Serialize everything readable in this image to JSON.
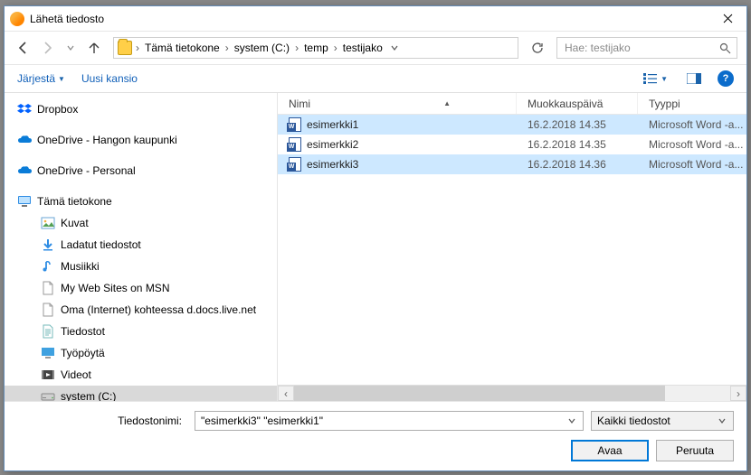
{
  "window": {
    "title": "Lähetä tiedosto"
  },
  "breadcrumb": {
    "segments": [
      "Tämä tietokone",
      "system (C:)",
      "temp",
      "testijako"
    ]
  },
  "search": {
    "placeholder": "Hae: testijako"
  },
  "toolbar": {
    "organize": "Järjestä",
    "new_folder": "Uusi kansio"
  },
  "columns": {
    "name": "Nimi",
    "modified": "Muokkauspäivä",
    "type": "Tyyppi"
  },
  "sidebar": {
    "items": [
      {
        "key": "dropbox",
        "label": "Dropbox",
        "icon": "dropbox",
        "indent": false
      },
      {
        "key": "spacer"
      },
      {
        "key": "od-hanko",
        "label": "OneDrive - Hangon kaupunki",
        "icon": "onedrive",
        "indent": false
      },
      {
        "key": "spacer"
      },
      {
        "key": "od-pers",
        "label": "OneDrive - Personal",
        "icon": "onedrive",
        "indent": false
      },
      {
        "key": "spacer"
      },
      {
        "key": "thispc",
        "label": "Tämä tietokone",
        "icon": "pc",
        "indent": false
      },
      {
        "key": "pictures",
        "label": "Kuvat",
        "icon": "img",
        "indent": true
      },
      {
        "key": "downloads",
        "label": "Ladatut tiedostot",
        "icon": "download",
        "indent": true
      },
      {
        "key": "music",
        "label": "Musiikki",
        "icon": "music",
        "indent": true
      },
      {
        "key": "msn",
        "label": "My Web Sites on MSN",
        "icon": "file",
        "indent": true
      },
      {
        "key": "oma",
        "label": "Oma (Internet) kohteessa d.docs.live.net",
        "icon": "file",
        "indent": true
      },
      {
        "key": "docs",
        "label": "Tiedostot",
        "icon": "doc",
        "indent": true
      },
      {
        "key": "desktop",
        "label": "Työpöytä",
        "icon": "desktop",
        "indent": true
      },
      {
        "key": "videos",
        "label": "Videot",
        "icon": "video",
        "indent": true
      },
      {
        "key": "systemc",
        "label": "system (C:)",
        "icon": "drive",
        "indent": true,
        "selected": true
      }
    ]
  },
  "files": [
    {
      "name": "esimerkki1",
      "date": "16.2.2018 14.35",
      "type": "Microsoft Word -a...",
      "selected": true
    },
    {
      "name": "esimerkki2",
      "date": "16.2.2018 14.35",
      "type": "Microsoft Word -a...",
      "selected": false
    },
    {
      "name": "esimerkki3",
      "date": "16.2.2018 14.36",
      "type": "Microsoft Word -a...",
      "selected": true
    }
  ],
  "footer": {
    "filename_label": "Tiedostonimi:",
    "filename_value": "\"esimerkki3\" \"esimerkki1\"",
    "filter": "Kaikki tiedostot",
    "open": "Avaa",
    "cancel": "Peruuta"
  }
}
